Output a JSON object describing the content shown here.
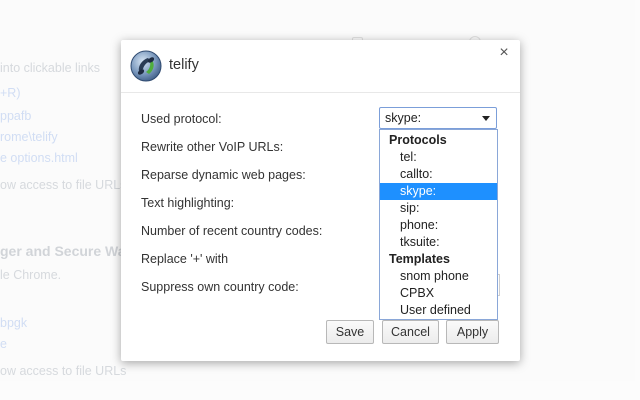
{
  "background": {
    "lines": [
      "into clickable links",
      "+R)",
      "ppafb",
      "rome\\telify",
      "e  options.html",
      "ow access to file URLs",
      "ger and Secure Wa",
      "le Chrome.",
      "bpgk",
      "e",
      "ow access to file URLs"
    ]
  },
  "dialog": {
    "title": "telify",
    "close_symbol": "×",
    "options": [
      "Used protocol:",
      "Rewrite other VoIP URLs:",
      "Reparse dynamic web pages:",
      "Text highlighting:",
      "Number of recent country codes:",
      "Replace '+' with",
      "Suppress own country code:"
    ],
    "protocol_select": {
      "value": "skype:",
      "dropdown": [
        {
          "label": "Protocols",
          "group": true
        },
        {
          "label": "tel:"
        },
        {
          "label": "callto:"
        },
        {
          "label": "skype:",
          "selected": true
        },
        {
          "label": "sip:"
        },
        {
          "label": "phone:"
        },
        {
          "label": "tksuite:"
        },
        {
          "label": "Templates",
          "group": true
        },
        {
          "label": "snom phone"
        },
        {
          "label": "CPBX"
        },
        {
          "label": "User defined"
        }
      ]
    },
    "buttons": {
      "save": "Save",
      "cancel": "Cancel",
      "apply": "Apply"
    }
  },
  "colors": {
    "selection": "#1e90ff",
    "select_border": "#7b9ed9"
  }
}
